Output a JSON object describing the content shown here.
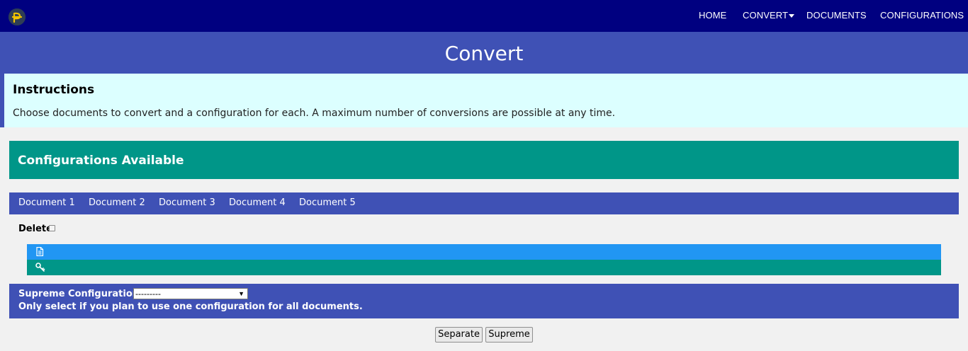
{
  "nav": {
    "items": [
      {
        "label": "HOME"
      },
      {
        "label": "CONVERT"
      },
      {
        "label": "DOCUMENTS"
      },
      {
        "label": "CONFIGURATIONS"
      }
    ],
    "brand_color": "#000080"
  },
  "header": {
    "title": "Convert"
  },
  "instructions": {
    "heading": "Instructions",
    "text": "Choose documents to convert and a configuration for each. A maximum number of conversions are possible at any time."
  },
  "configurations": {
    "title": "Configurations Available"
  },
  "documents": {
    "tabs": [
      "Document 1",
      "Document 2",
      "Document 3",
      "Document 4",
      "Document 5"
    ]
  },
  "delete": {
    "label": "Delete",
    "checked": false
  },
  "rows": {
    "document_icon": "document-icon",
    "key_icon": "key-icon"
  },
  "supreme": {
    "label": "Supreme Configuration:",
    "selected": "---------",
    "note": "Only select if you plan to use one configuration for all documents."
  },
  "buttons": {
    "separate": "Separate",
    "supreme": "Supreme"
  },
  "colors": {
    "accent": "#3f51b5",
    "teal": "#009688",
    "blue": "#2196f3",
    "panel": "#dcffff"
  }
}
